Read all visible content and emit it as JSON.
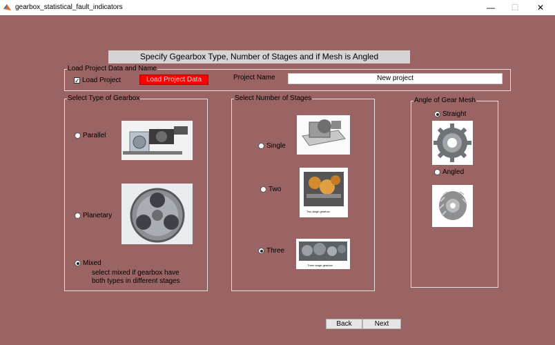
{
  "window": {
    "title": "gearbox_statistical_fault_indicators",
    "minimize": "—",
    "maximize": "☐",
    "close": "✕"
  },
  "header": {
    "text": "Specify Ggearbox Type, Number of Stages and if Mesh is Angled"
  },
  "load_panel": {
    "title": "Load Project Data and Name",
    "load_project_label": "Load Project",
    "load_project_checked": true,
    "load_button": "Load Project Data",
    "load_button_color": "#ff0000",
    "project_name_label": "Project Name",
    "project_name_value": "New project"
  },
  "gearbox_type": {
    "title": "Select Type of Gearbox",
    "options": [
      {
        "label": "Parallel",
        "selected": false
      },
      {
        "label": "Planetary",
        "selected": false
      },
      {
        "label": "Mixed",
        "selected": true
      }
    ],
    "mixed_note_line1": "select mixed if gearbox have",
    "mixed_note_line2": "both types in different stages"
  },
  "stages": {
    "title": "Select Number of Stages",
    "options": [
      {
        "label": "Single",
        "selected": false
      },
      {
        "label": "Two",
        "selected": false
      },
      {
        "label": "Three",
        "selected": true
      }
    ],
    "two_stage_caption": "Two stage gearbox",
    "three_stage_caption": "Three stage gearbox"
  },
  "mesh": {
    "title": "Angle of Gear Mesh",
    "options": [
      {
        "label": "Straight",
        "selected": true
      },
      {
        "label": "Angled",
        "selected": false
      }
    ]
  },
  "nav": {
    "back": "Back",
    "next": "Next"
  },
  "colors": {
    "background": "#9a6464",
    "header_bg": "#d4d4d4",
    "accent_red": "#ff0000"
  }
}
